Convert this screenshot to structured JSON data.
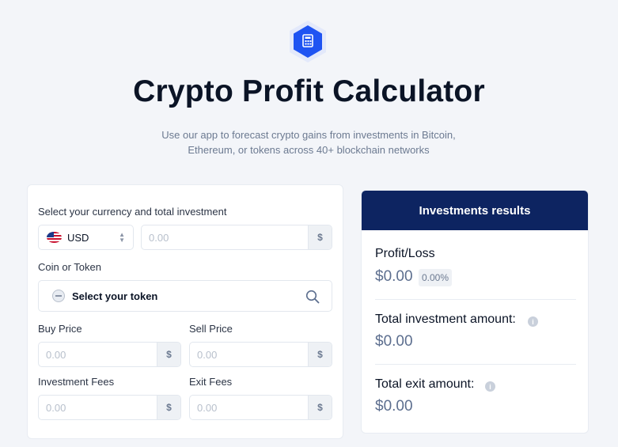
{
  "hero": {
    "icon": "calculator-icon",
    "accent_color": "#1f54f2",
    "title": "Crypto Profit Calculator",
    "subtitle_line1": "Use our app to forecast crypto gains from investments in Bitcoin,",
    "subtitle_line2": "Ethereum, or tokens across 40+ blockchain networks"
  },
  "form": {
    "currency_label": "Select your currency and total investment",
    "currency_value": "USD",
    "currency_flag": "us-flag-icon",
    "investment_placeholder": "0.00",
    "currency_symbol": "$",
    "coin_label": "Coin or Token",
    "token_placeholder": "Select your token",
    "buy_price_label": "Buy Price",
    "buy_price_placeholder": "0.00",
    "sell_price_label": "Sell Price",
    "sell_price_placeholder": "0.00",
    "investment_fees_label": "Investment Fees",
    "investment_fees_placeholder": "0.00",
    "exit_fees_label": "Exit Fees",
    "exit_fees_placeholder": "0.00"
  },
  "results": {
    "header": "Investments results",
    "header_color": "#0d2461",
    "profit_label": "Profit/Loss",
    "profit_value": "$0.00",
    "profit_percent": "0.00%",
    "total_investment_label": "Total investment amount:",
    "total_investment_value": "$0.00",
    "total_exit_label": "Total exit amount:",
    "total_exit_value": "$0.00"
  }
}
